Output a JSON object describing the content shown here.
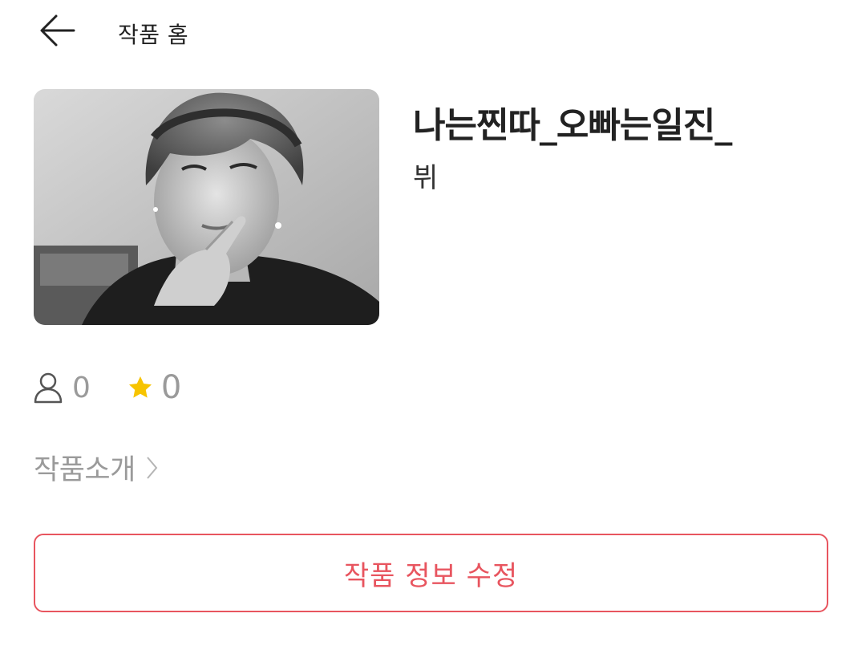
{
  "header": {
    "back_icon": "arrow-left-icon",
    "title": "작품 홈"
  },
  "work": {
    "title": "나는찐따_오빠는일진_",
    "author": "뷔",
    "cover_description": "grayscale photo cover"
  },
  "stats": {
    "readers_icon": "person-icon",
    "readers": "0",
    "stars_icon": "star-icon",
    "stars": "0"
  },
  "intro": {
    "label": "작품소개",
    "chevron_icon": "chevron-right-icon"
  },
  "actions": {
    "edit_label": "작품 정보 수정"
  },
  "colors": {
    "accent": "#e8555f",
    "star": "#f7c400",
    "muted_text": "#9a9a9a",
    "text": "#222222"
  }
}
